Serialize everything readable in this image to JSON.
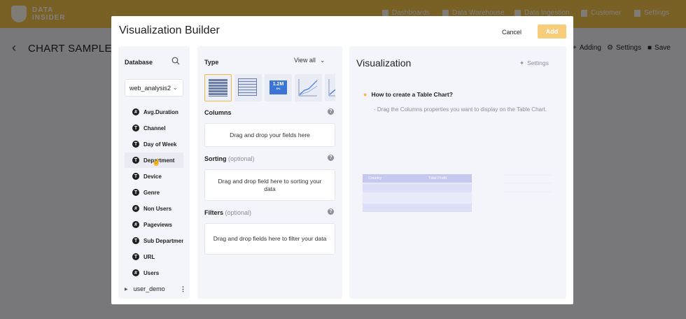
{
  "app": {
    "brand_line1": "DATA",
    "brand_line2": "INSIDER",
    "nav": [
      {
        "label": "Dashboards",
        "icon": "dashboard-icon"
      },
      {
        "label": "Data Warehouse",
        "icon": "database-icon"
      },
      {
        "label": "Data Ingestion",
        "icon": "document-icon"
      },
      {
        "label": "Customer",
        "icon": "user-icon"
      },
      {
        "label": "Settings",
        "icon": "gear-icon"
      }
    ]
  },
  "page": {
    "title": "CHART SAMPLE",
    "actions": [
      {
        "label": "Adding",
        "icon": "plus-icon"
      },
      {
        "label": "Settings",
        "icon": "gear-icon"
      },
      {
        "label": "Save",
        "icon": "save-icon"
      }
    ]
  },
  "modal": {
    "title": "Visualization Builder",
    "cancel_label": "Cancel",
    "add_label": "Add",
    "database": {
      "label": "Database",
      "selected": "web_analysis2",
      "fields": [
        {
          "type_symbol": "#",
          "name": "Avg.Duration"
        },
        {
          "type_symbol": "T",
          "name": "Channel"
        },
        {
          "type_symbol": "T",
          "name": "Day of Week"
        },
        {
          "type_symbol": "T",
          "name": "Department"
        },
        {
          "type_symbol": "T",
          "name": "Device"
        },
        {
          "type_symbol": "T",
          "name": "Genre"
        },
        {
          "type_symbol": "#",
          "name": "Non Users"
        },
        {
          "type_symbol": "#",
          "name": "Pageviews"
        },
        {
          "type_symbol": "T",
          "name": "Sub Department"
        },
        {
          "type_symbol": "T",
          "name": "URL"
        },
        {
          "type_symbol": "#",
          "name": "Users"
        }
      ],
      "sub_database": "user_demo"
    },
    "builder": {
      "type_label": "Type",
      "view_all_label": "View all",
      "types": [
        {
          "name": "table",
          "active": true
        },
        {
          "name": "pivot-table",
          "active": false
        },
        {
          "name": "kpi",
          "active": false,
          "kpi_value": "1.2M",
          "kpi_sub": "5%"
        },
        {
          "name": "line",
          "active": false
        },
        {
          "name": "area",
          "active": false
        }
      ],
      "columns_label": "Columns",
      "columns_placeholder": "Drag and drop your fields here",
      "sorting_label": "Sorting",
      "sorting_optional": "(optional)",
      "sorting_placeholder": "Drag and drop field here to sorting your data",
      "filters_label": "Filters",
      "filters_optional": "(optional)",
      "filters_placeholder": "Drag and drop fields here to filter your data"
    },
    "visualization": {
      "title": "Visualization",
      "settings_label": "Settings",
      "howto_title": "How to create a Table Chart?",
      "howto_desc": "- Drag the Columns properties you want to display on the Table Chart.",
      "preview_headers": [
        "Country",
        "Total Profit"
      ]
    }
  }
}
